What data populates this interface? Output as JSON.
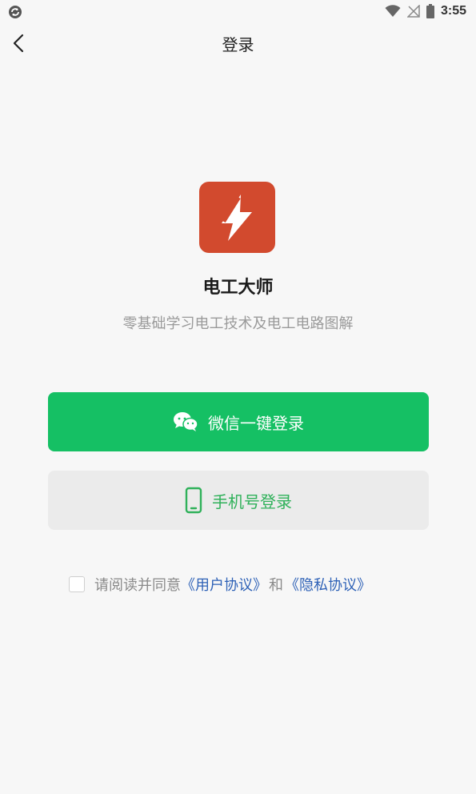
{
  "status_bar": {
    "time": "3:55",
    "app_icon": "sync-icon",
    "wifi_icon": "wifi-icon",
    "signal_icon": "no-signal-icon",
    "battery_icon": "battery-icon"
  },
  "header": {
    "back_icon": "chevron-left-icon",
    "title": "登录"
  },
  "app": {
    "logo_icon": "lightning-logo-icon",
    "name": "电工大师",
    "tagline": "零基础学习电工技术及电工电路图解"
  },
  "buttons": {
    "wechat_login": "微信一键登录",
    "wechat_icon": "wechat-icon",
    "phone_login": "手机号登录",
    "phone_icon": "phone-icon"
  },
  "agreement": {
    "checked": false,
    "prefix": "请阅读并同意",
    "user_agreement": "《用户协议》",
    "connector": "和",
    "privacy_agreement": "《隐私协议》"
  },
  "colors": {
    "wechat_green": "#15c064",
    "phone_green": "#2fb15a",
    "logo_orange": "#d24a2e",
    "link_blue": "#2f62b7",
    "background": "#f7f7f7"
  }
}
